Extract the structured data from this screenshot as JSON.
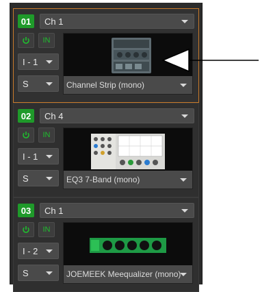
{
  "slots": [
    {
      "number": "01",
      "channel": "Ch 1",
      "in_label": "IN",
      "io": "I - 1",
      "solo": "S",
      "plugin": "Channel Strip (mono)",
      "selected": true
    },
    {
      "number": "02",
      "channel": "Ch 4",
      "in_label": "IN",
      "io": "I - 1",
      "solo": "S",
      "plugin": "EQ3 7-Band (mono)",
      "selected": false
    },
    {
      "number": "03",
      "channel": "Ch 1",
      "in_label": "IN",
      "io": "I - 2",
      "solo": "S",
      "plugin": "JOEMEEK Meequalizer (mono)",
      "selected": false
    }
  ],
  "colors": {
    "accent_selected": "#c97a2a",
    "slot_number_bg": "#1f9a2a",
    "in_text": "#1fbe2e"
  },
  "icons": [
    "power-icon",
    "chevron-down-icon",
    "arrow-left-icon"
  ]
}
